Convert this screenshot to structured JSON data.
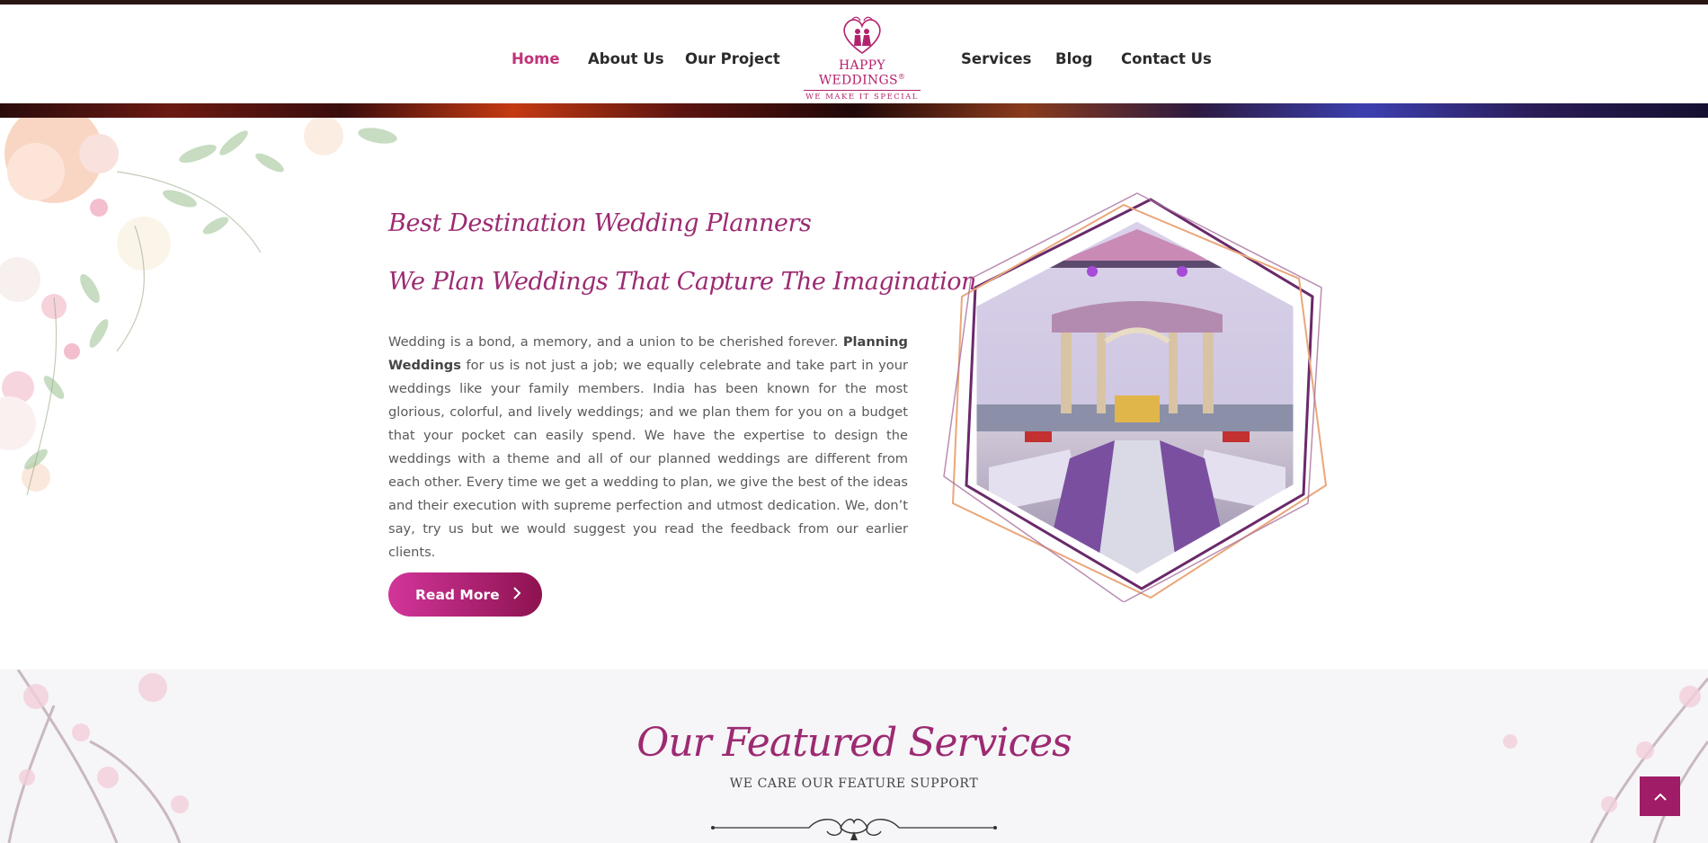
{
  "nav": {
    "items": [
      {
        "label": "Home",
        "active": true
      },
      {
        "label": "About Us",
        "active": false
      },
      {
        "label": "Our Project",
        "active": false
      },
      {
        "label": "Services",
        "active": false
      },
      {
        "label": "Blog",
        "active": false
      },
      {
        "label": "Contact Us",
        "active": false
      }
    ]
  },
  "logo": {
    "name": "HAPPY WEDDINGS",
    "registered": "®",
    "tagline": "WE MAKE IT SPECIAL"
  },
  "about": {
    "heading_1": "Best Destination Wedding Planners",
    "heading_2": "We Plan Weddings That Capture The Imagination",
    "paragraph_start": "Wedding is a bond, a memory, and a union to be cherished forever. ",
    "paragraph_bold": "Planning Weddings",
    "paragraph_rest": " for us is not just a job; we equally celebrate and take part in your weddings like your family members. India has been known for the most glorious, colorful, and lively weddings; and we plan them for you on a budget that your pocket can easily spend. We have the expertise to design the weddings with a theme and all of our planned weddings are different from each other. Every time we get a wedding to plan, we give the best of the ideas and their execution with supreme perfection and utmost dedication. We, don’t say, try us but we would suggest you read the feedback from our earlier clients.",
    "read_more_label": "Read More"
  },
  "services": {
    "title": "Our Featured Services",
    "subtitle": "WE CARE OUR FEATURE SUPPORT"
  },
  "icons": {
    "read_more": "chevron-right-icon",
    "back_to_top": "chevron-up-icon",
    "logo": "couple-heart-icon"
  },
  "colors": {
    "brand": "#9c2a72",
    "nav_active": "#c2337a",
    "button_start": "#d2359a",
    "button_end": "#8d1350",
    "back_to_top": "#a01c66"
  }
}
